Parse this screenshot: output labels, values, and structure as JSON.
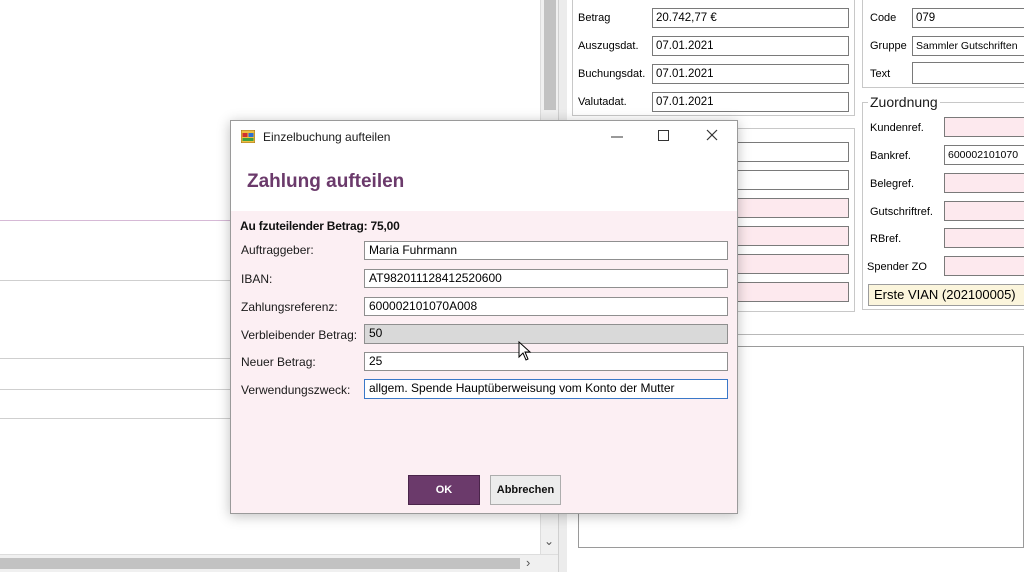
{
  "allgemein": {
    "betrag_label": "Betrag",
    "betrag_value": "20.742,77 €",
    "auszugsdat_label": "Auszugsdat.",
    "auszugsdat_value": "07.01.2021",
    "buchungsdat_label": "Buchungsdat.",
    "buchungsdat_value": "07.01.2021",
    "valutadat_label": "Valutadat.",
    "valutadat_value": "07.01.2021"
  },
  "buchung": {
    "code_label": "Code",
    "code_value": "079",
    "gruppe_label": "Gruppe",
    "gruppe_value": "Sammler Gutschriften",
    "text_label": "Text",
    "text_value": ""
  },
  "zuordnung": {
    "title": "Zuordnung",
    "kundenref_label": "Kundenref.",
    "kundenref_value": "",
    "bankref_label": "Bankref.",
    "bankref_value": "600002101070",
    "belegref_label": "Belegref.",
    "belegref_value": "",
    "gutschriftref_label": "Gutschriftref.",
    "gutschriftref_value": "",
    "rbref_label": "RBref.",
    "rbref_value": "",
    "spender_zo_label": "Spender ZO",
    "spender_zo_value": "",
    "spender_name": "Erste VIAN (202100005)"
  },
  "dialog": {
    "window_title": "Einzelbuchung aufteilen",
    "heading": "Zahlung aufteilen",
    "amount_line": "Au fzuteilender Betrag: 75,00",
    "fields": {
      "auftraggeber_label": "Auftraggeber:",
      "auftraggeber_value": "Maria Fuhrmann",
      "iban_label": "IBAN:",
      "iban_value": "AT982011128412520600",
      "zahlungsreferenz_label": "Zahlungsreferenz:",
      "zahlungsreferenz_value": "600002101070A008",
      "verbleibender_label": "Verbleibender Betrag:",
      "verbleibender_value": "50",
      "neuer_label": "Neuer Betrag:",
      "neuer_value": "25",
      "verwendungszweck_label": "Verwendungszweck:",
      "verwendungszweck_value": "allgem. Spende Hauptüberweisung vom Konto der Mutter"
    },
    "ok_label": "OK",
    "cancel_label": "Abbrechen"
  },
  "colors": {
    "accent": "#6b3a6b",
    "heading": "#6b3a6b",
    "pink_field": "#fde9ee",
    "dialog_bg": "#fceff3"
  },
  "icons": {
    "app": "app-window-icon",
    "minimize": "minimize-icon",
    "maximize": "maximize-icon",
    "close": "close-icon"
  }
}
